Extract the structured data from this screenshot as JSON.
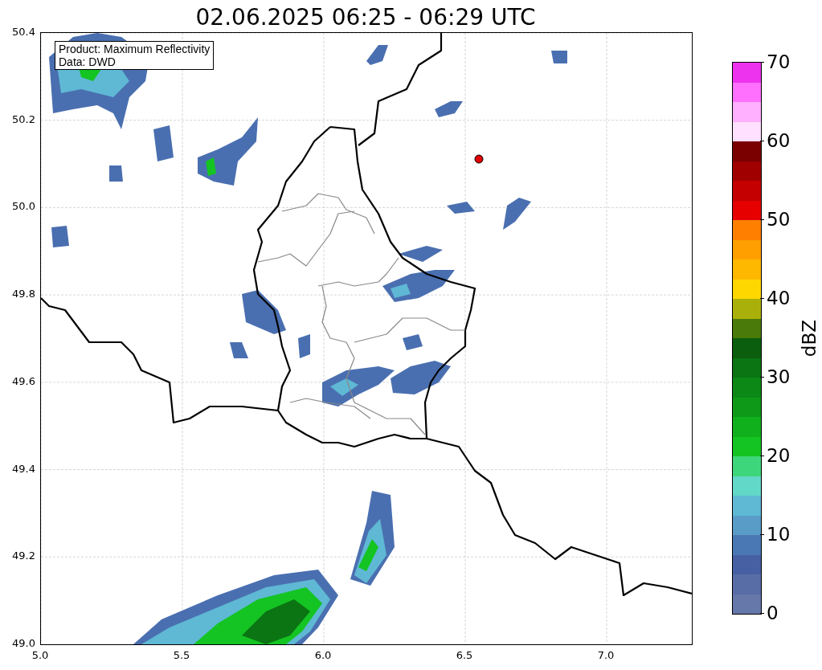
{
  "title": "02.06.2025 06:25 - 06:29 UTC",
  "map": {
    "info_box": [
      "Product: Maximum Reflectivity",
      "Data: DWD"
    ],
    "x_ticks": [
      "5.0",
      "5.5",
      "6.0",
      "6.5",
      "7.0"
    ],
    "y_ticks": [
      "50.4",
      "50.2",
      "50.0",
      "49.8",
      "49.6",
      "49.4",
      "49.2",
      "49.0"
    ]
  },
  "colorbar": {
    "label": "dBZ",
    "ticks": [
      "70",
      "60",
      "50",
      "40",
      "30",
      "20",
      "10",
      "0"
    ],
    "segments": [
      {
        "color": "#ee33ee"
      },
      {
        "color": "#ff70ff"
      },
      {
        "color": "#ffb0ff"
      },
      {
        "color": "#ffe0ff"
      },
      {
        "color": "#7a0000"
      },
      {
        "color": "#a00000"
      },
      {
        "color": "#c40000"
      },
      {
        "color": "#e60000"
      },
      {
        "color": "#ff8000"
      },
      {
        "color": "#ff9f00"
      },
      {
        "color": "#ffb800"
      },
      {
        "color": "#ffd700"
      },
      {
        "color": "#aab00a"
      },
      {
        "color": "#4a7a0a"
      },
      {
        "color": "#0b5e0d"
      },
      {
        "color": "#0b7413"
      },
      {
        "color": "#0c8816"
      },
      {
        "color": "#0e9a18"
      },
      {
        "color": "#10b01c"
      },
      {
        "color": "#14c422"
      },
      {
        "color": "#3ed67a"
      },
      {
        "color": "#62d8c8"
      },
      {
        "color": "#5fb8d4"
      },
      {
        "color": "#5a9cc8"
      },
      {
        "color": "#4a78b4"
      },
      {
        "color": "#4760a3"
      },
      {
        "color": "#586da6"
      },
      {
        "color": "#6677a9"
      }
    ]
  }
}
